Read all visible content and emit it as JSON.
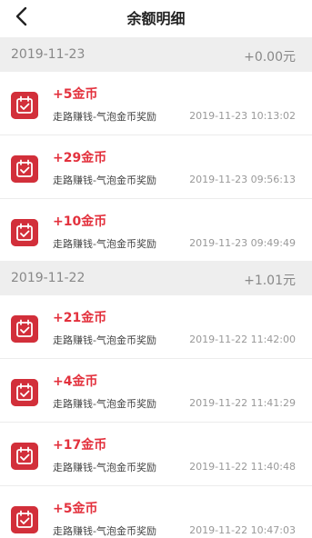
{
  "header": {
    "title": "余额明细",
    "back_icon": "chevron-left-icon"
  },
  "colors": {
    "accent": "#e3313d",
    "icon_bg": "#d22f3a",
    "group_bg": "#eeeeee"
  },
  "groups": [
    {
      "date": "2019-11-23",
      "total": "+0.00元",
      "records": [
        {
          "amount": "+5金币",
          "desc": "走路赚钱-气泡金币奖励",
          "time": "2019-11-23 10:13:02",
          "icon": "calendar-check-icon"
        },
        {
          "amount": "+29金币",
          "desc": "走路赚钱-气泡金币奖励",
          "time": "2019-11-23 09:56:13",
          "icon": "calendar-check-icon"
        },
        {
          "amount": "+10金币",
          "desc": "走路赚钱-气泡金币奖励",
          "time": "2019-11-23 09:49:49",
          "icon": "calendar-check-icon"
        }
      ]
    },
    {
      "date": "2019-11-22",
      "total": "+1.01元",
      "records": [
        {
          "amount": "+21金币",
          "desc": "走路赚钱-气泡金币奖励",
          "time": "2019-11-22 11:42:00",
          "icon": "calendar-check-icon"
        },
        {
          "amount": "+4金币",
          "desc": "走路赚钱-气泡金币奖励",
          "time": "2019-11-22 11:41:29",
          "icon": "calendar-check-icon"
        },
        {
          "amount": "+17金币",
          "desc": "走路赚钱-气泡金币奖励",
          "time": "2019-11-22 11:40:48",
          "icon": "calendar-check-icon"
        },
        {
          "amount": "+5金币",
          "desc": "走路赚钱-气泡金币奖励",
          "time": "2019-11-22 10:47:03",
          "icon": "calendar-check-icon"
        }
      ]
    }
  ]
}
